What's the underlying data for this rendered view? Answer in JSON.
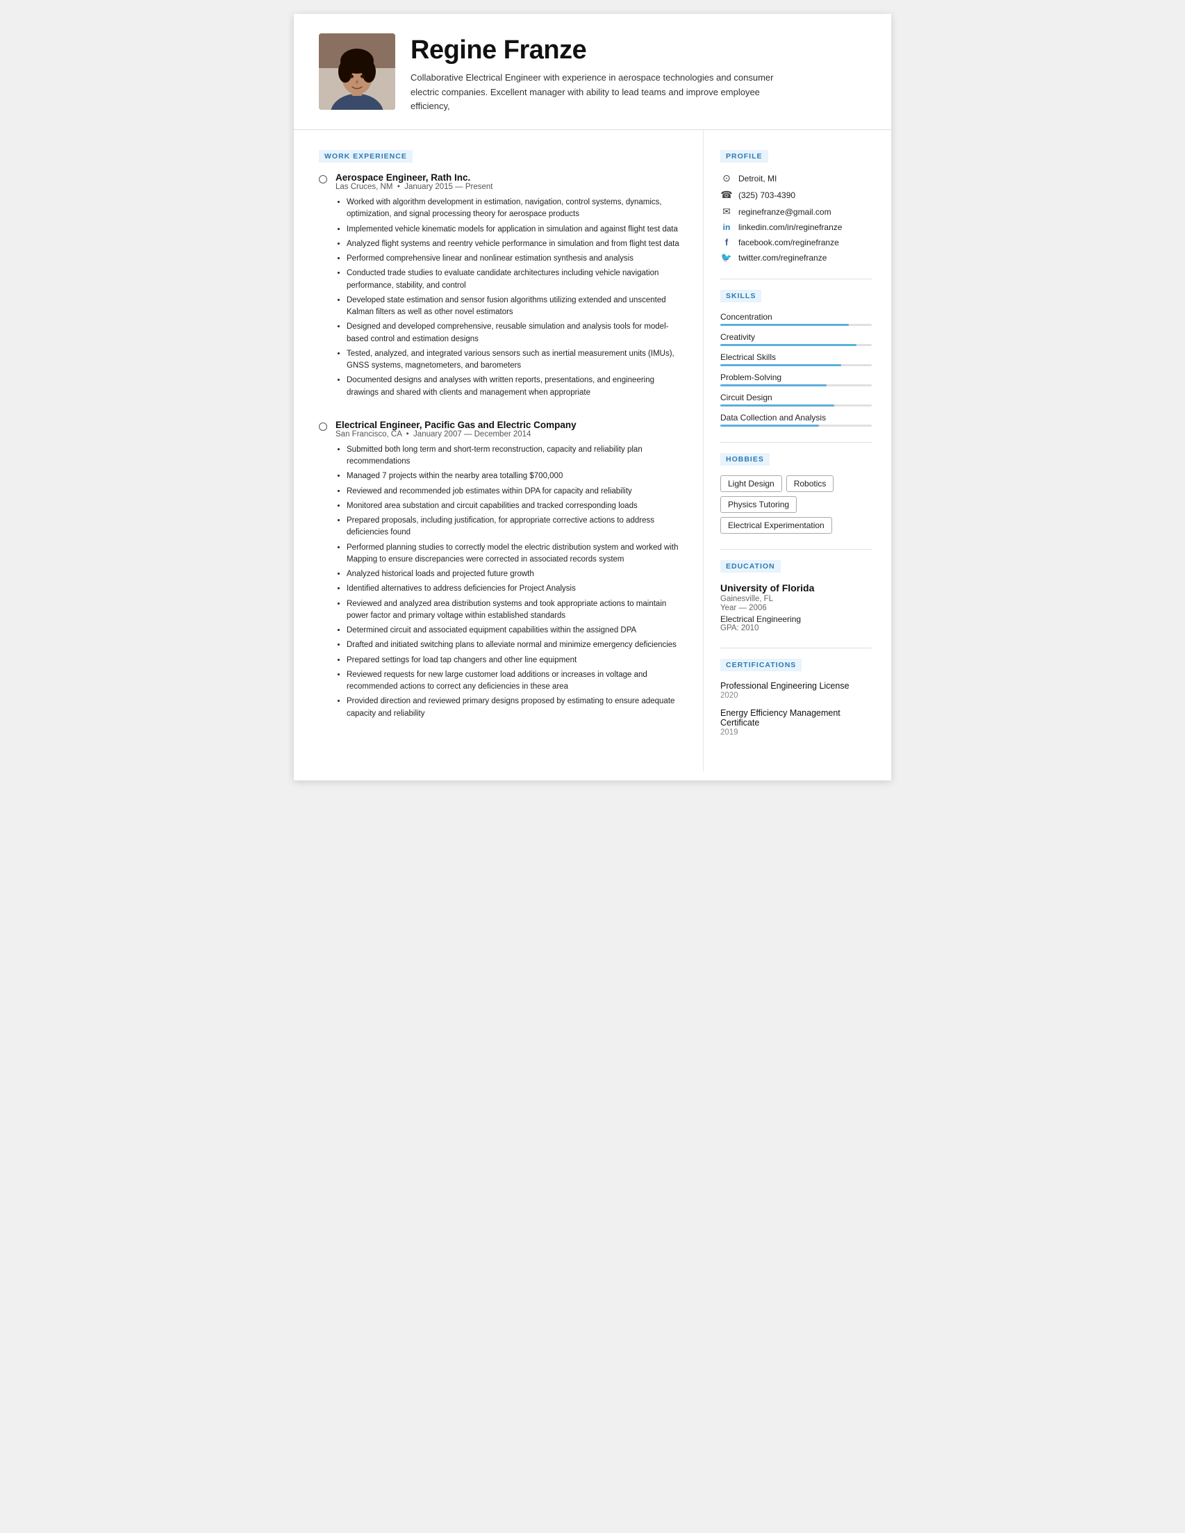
{
  "header": {
    "name": "Regine Franze",
    "tagline": "Collaborative Electrical Engineer with experience in aerospace technologies and consumer electric companies. Excellent manager with ability to lead teams and improve employee efficiency,"
  },
  "profile": {
    "section_title": "PROFILE",
    "location": "Detroit, MI",
    "phone": "(325) 703-4390",
    "email": "reginefranze@gmail.com",
    "linkedin": "linkedin.com/in/reginefranze",
    "facebook": "facebook.com/reginefranze",
    "twitter": "twitter.com/reginefranze"
  },
  "work_experience": {
    "section_title": "WORK EXPERIENCE",
    "jobs": [
      {
        "title": "Aerospace Engineer, Rath Inc.",
        "location": "Las Cruces, NM",
        "dates": "January 2015 — Present",
        "bullets": [
          "Worked with algorithm development in estimation, navigation, control systems, dynamics, optimization, and signal processing theory for aerospace products",
          "Implemented vehicle kinematic models for application in simulation and against flight test data",
          "Analyzed flight systems and reentry vehicle performance in simulation and from flight test data",
          "Performed comprehensive linear and nonlinear estimation synthesis and analysis",
          "Conducted trade studies to evaluate candidate architectures including vehicle navigation performance, stability, and control",
          "Developed state estimation and sensor fusion algorithms utilizing extended and unscented Kalman filters as well as other novel estimators",
          "Designed and developed comprehensive, reusable simulation and analysis tools for model-based control and estimation designs",
          "Tested, analyzed, and integrated various sensors such as inertial measurement units (IMUs), GNSS systems, magnetometers, and barometers",
          "Documented designs and analyses with written reports, presentations, and engineering drawings and shared with clients and management when appropriate"
        ]
      },
      {
        "title": "Electrical Engineer, Pacific Gas and Electric Company",
        "location": "San Francisco, CA",
        "dates": "January 2007 — December 2014",
        "bullets": [
          "Submitted both long term and short-term reconstruction, capacity and reliability plan recommendations",
          "Managed 7 projects within the nearby area totalling $700,000",
          "Reviewed and recommended job estimates within DPA for capacity and reliability",
          "Monitored area substation and circuit capabilities and tracked corresponding loads",
          "Prepared proposals, including justification, for appropriate corrective actions to address deficiencies found",
          "Performed planning studies to correctly model the electric distribution system and worked with Mapping to ensure discrepancies were corrected in associated records system",
          "Analyzed historical loads and projected future growth",
          "Identified alternatives to address deficiencies for Project Analysis",
          "Reviewed and analyzed area distribution systems and took appropriate actions to maintain power factor and primary voltage within established standards",
          "Determined circuit and associated equipment capabilities within the assigned DPA",
          "Drafted and initiated switching plans to alleviate normal and minimize emergency deficiencies",
          "Prepared settings for load tap changers and other line equipment",
          "Reviewed requests for new large customer load additions or increases in voltage and recommended actions to correct any deficiencies in these area",
          "Provided direction and reviewed primary designs proposed by estimating to ensure adequate capacity and reliability"
        ]
      }
    ]
  },
  "skills": {
    "section_title": "SKILLS",
    "items": [
      {
        "name": "Concentration",
        "pct": 85
      },
      {
        "name": "Creativity",
        "pct": 90
      },
      {
        "name": "Electrical Skills",
        "pct": 80
      },
      {
        "name": "Problem-Solving",
        "pct": 70
      },
      {
        "name": "Circuit Design",
        "pct": 75
      },
      {
        "name": "Data Collection and Analysis",
        "pct": 65
      }
    ]
  },
  "hobbies": {
    "section_title": "HOBBIES",
    "items": [
      "Light Design",
      "Robotics",
      "Physics Tutoring",
      "Electrical Experimentation"
    ]
  },
  "education": {
    "section_title": "EDUCATION",
    "school": "University of Florida",
    "city": "Gainesville, FL",
    "year_label": "Year — 2006",
    "field": "Electrical Engineering",
    "gpa": "GPA: 2010"
  },
  "certifications": {
    "section_title": "CERTIFICATIONS",
    "items": [
      {
        "name": "Professional Engineering License",
        "year": "2020"
      },
      {
        "name": "Energy Efficiency Management Certificate",
        "year": "2019"
      }
    ]
  }
}
